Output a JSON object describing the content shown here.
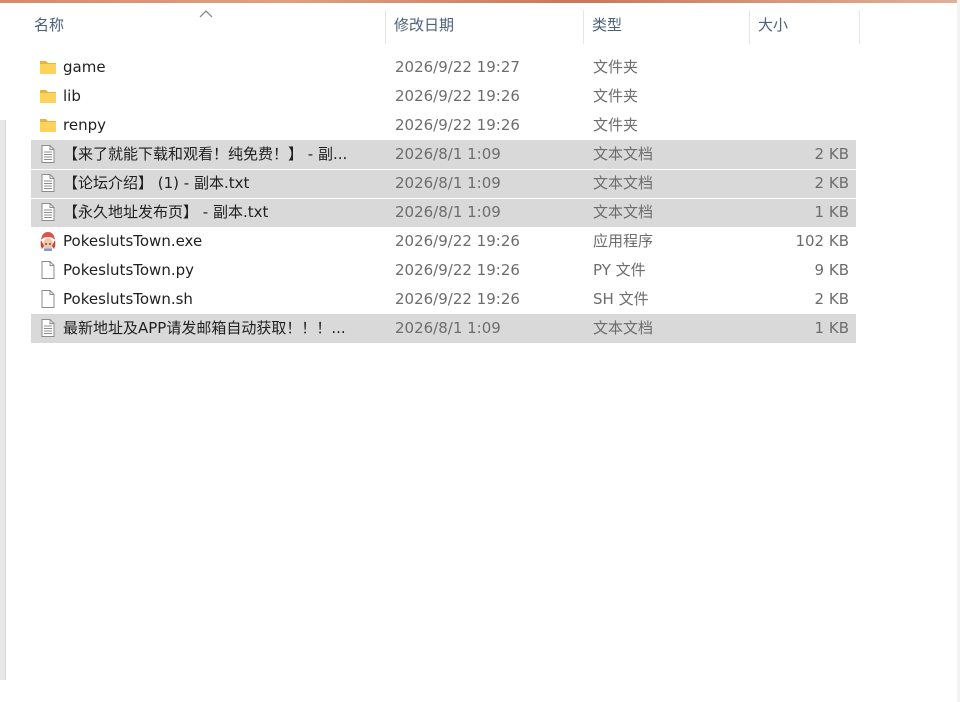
{
  "header": {
    "name": "名称",
    "date": "修改日期",
    "type": "类型",
    "size": "大小"
  },
  "files": [
    {
      "name": "game",
      "date": "2026/9/22 19:27",
      "type": "文件夹",
      "size": "",
      "icon": "folder-icon",
      "selected": false
    },
    {
      "name": "lib",
      "date": "2026/9/22 19:26",
      "type": "文件夹",
      "size": "",
      "icon": "folder-icon",
      "selected": false
    },
    {
      "name": "renpy",
      "date": "2026/9/22 19:26",
      "type": "文件夹",
      "size": "",
      "icon": "folder-icon",
      "selected": false
    },
    {
      "name": "【来了就能下载和观看！纯免费！】 - 副...",
      "date": "2026/8/1 1:09",
      "type": "文本文档",
      "size": "2 KB",
      "icon": "text-file-icon",
      "selected": true
    },
    {
      "name": "【论坛介绍】 (1) - 副本.txt",
      "date": "2026/8/1 1:09",
      "type": "文本文档",
      "size": "2 KB",
      "icon": "text-file-icon",
      "selected": true
    },
    {
      "name": "【永久地址发布页】 - 副本.txt",
      "date": "2026/8/1 1:09",
      "type": "文本文档",
      "size": "1 KB",
      "icon": "text-file-icon",
      "selected": true
    },
    {
      "name": "PokeslutsTown.exe",
      "date": "2026/9/22 19:26",
      "type": "应用程序",
      "size": "102 KB",
      "icon": "app-icon",
      "selected": false
    },
    {
      "name": "PokeslutsTown.py",
      "date": "2026/9/22 19:26",
      "type": "PY 文件",
      "size": "9 KB",
      "icon": "blank-file-icon",
      "selected": false
    },
    {
      "name": "PokeslutsTown.sh",
      "date": "2026/9/22 19:26",
      "type": "SH 文件",
      "size": "2 KB",
      "icon": "blank-file-icon",
      "selected": false
    },
    {
      "name": "最新地址及APP请发邮箱自动获取！！！...",
      "date": "2026/8/1 1:09",
      "type": "文本文档",
      "size": "1 KB",
      "icon": "text-file-icon",
      "selected": true
    }
  ]
}
